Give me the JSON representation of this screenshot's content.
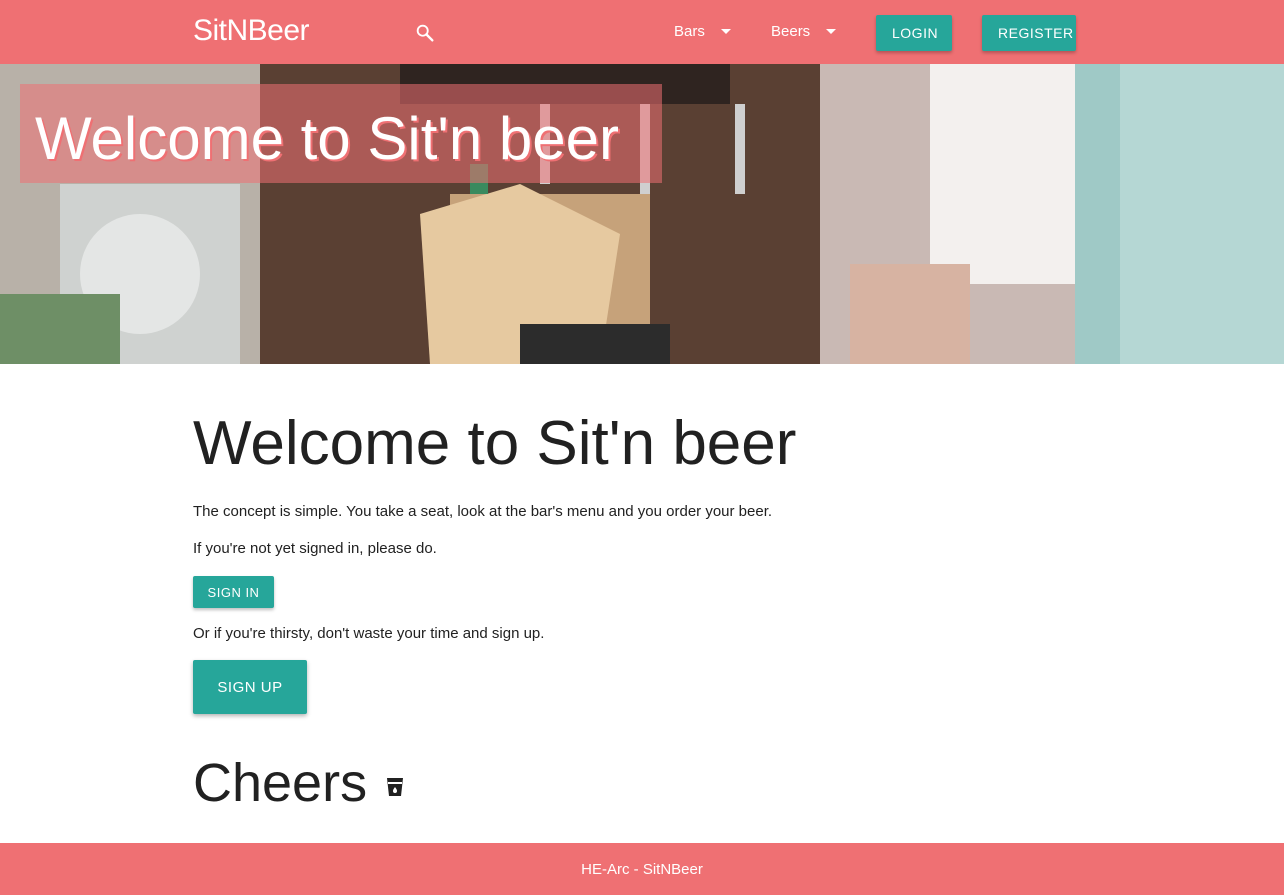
{
  "nav": {
    "brand": "SitNBeer",
    "search_icon": "search-icon",
    "menus": [
      "Bars",
      "Beers"
    ],
    "login_label": "LOGIN",
    "register_label": "REGISTER"
  },
  "hero": {
    "title": "Welcome to Sit'n beer"
  },
  "main": {
    "title": "Welcome to Sit'n beer",
    "intro": "The concept is simple. You take a seat, look at the bar's menu and you order your beer.",
    "signin_prompt": "If you're not yet signed in, please do.",
    "signin_label": "SIGN IN",
    "signup_prompt": "Or if you're thirsty, don't waste your time and sign up.",
    "signup_label": "SIGN UP",
    "cheers": "Cheers",
    "cheers_icon": "drink-cup-icon"
  },
  "footer": {
    "text": "HE-Arc - SitNBeer"
  },
  "colors": {
    "primary": "#ef7073",
    "accent": "#26a69a",
    "text": "#212121"
  }
}
